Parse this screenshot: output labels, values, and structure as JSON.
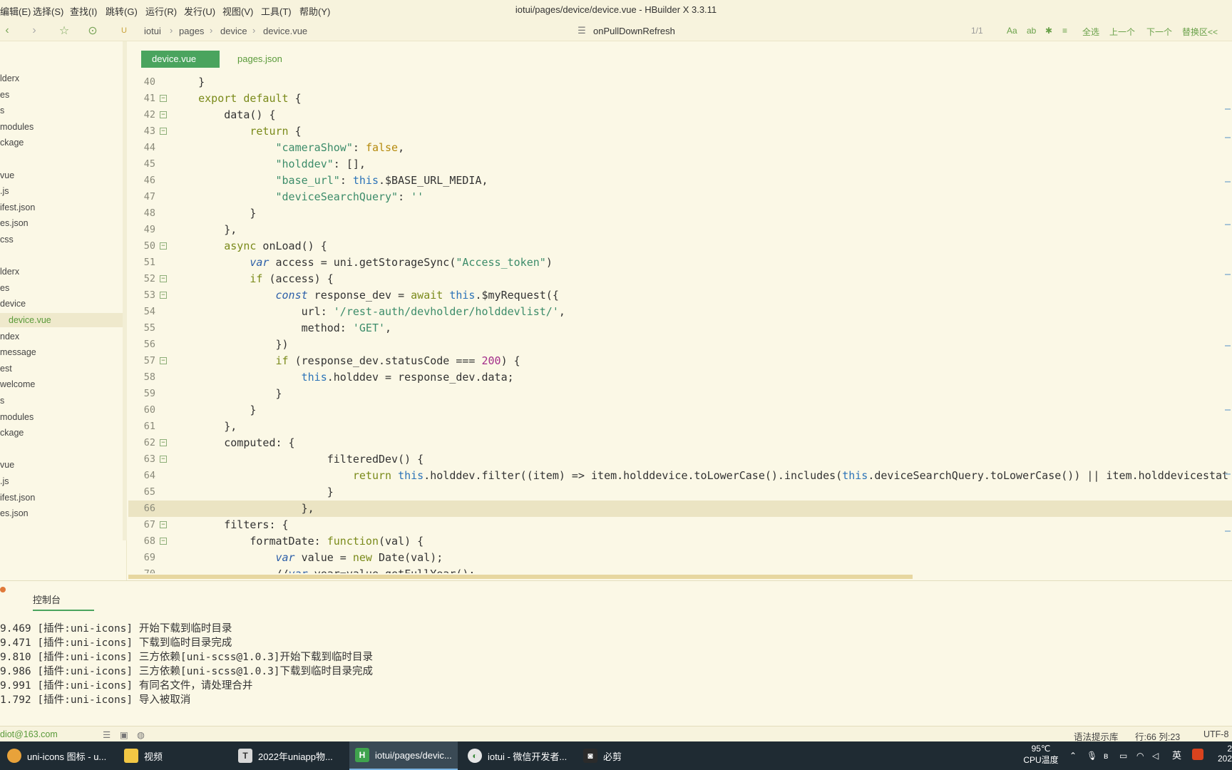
{
  "menubar": {
    "items": [
      "编辑(E)",
      "选择(S)",
      "查找(I)",
      "跳转(G)",
      "运行(R)",
      "发行(U)",
      "视图(V)",
      "工具(T)",
      "帮助(Y)"
    ],
    "title": "iotui/pages/device/device.vue - HBuilder X 3.3.11"
  },
  "toolbar": {
    "breadcrumb": [
      "iotui",
      "pages",
      "device",
      "device.vue"
    ],
    "find_query": "onPullDownRefresh",
    "find_count": "1/1",
    "find_tools": [
      "Aa",
      "ab",
      "全选",
      "上一个",
      "下一个",
      "替换区<<"
    ]
  },
  "sidebar": {
    "items": [
      "lderx",
      "es",
      "s",
      "modules",
      "ckage",
      "",
      "vue",
      ".js",
      "ifest.json",
      "es.json",
      "css",
      "",
      "lderx",
      "es",
      "device",
      "device.vue",
      "ndex",
      "message",
      "est",
      "welcome",
      "s",
      "modules",
      "ckage",
      "",
      "vue",
      ".js",
      "ifest.json",
      "es.json"
    ],
    "active_index": 15
  },
  "tabs": [
    {
      "label": "device.vue",
      "active": true
    },
    {
      "label": "pages.json",
      "active": false
    }
  ],
  "code": {
    "current_line": 66,
    "lines": [
      {
        "n": "40",
        "fold": false,
        "text": "    }"
      },
      {
        "n": "41",
        "fold": true,
        "text": "    export default {"
      },
      {
        "n": "42",
        "fold": true,
        "text": "        data() {"
      },
      {
        "n": "43",
        "fold": true,
        "text": "            return {"
      },
      {
        "n": "44",
        "fold": false,
        "text": "                \"cameraShow\": false,"
      },
      {
        "n": "45",
        "fold": false,
        "text": "                \"holddev\": [],"
      },
      {
        "n": "46",
        "fold": false,
        "text": "                \"base_url\": this.$BASE_URL_MEDIA,"
      },
      {
        "n": "47",
        "fold": false,
        "text": "                \"deviceSearchQuery\": ''"
      },
      {
        "n": "48",
        "fold": false,
        "text": "            }"
      },
      {
        "n": "49",
        "fold": false,
        "text": "        },"
      },
      {
        "n": "50",
        "fold": true,
        "text": "        async onLoad() {"
      },
      {
        "n": "51",
        "fold": false,
        "text": "            var access = uni.getStorageSync(\"Access_token\")"
      },
      {
        "n": "52",
        "fold": true,
        "text": "            if (access) {"
      },
      {
        "n": "53",
        "fold": true,
        "text": "                const response_dev = await this.$myRequest({"
      },
      {
        "n": "54",
        "fold": false,
        "text": "                    url: '/rest-auth/devholder/holddevlist/',"
      },
      {
        "n": "55",
        "fold": false,
        "text": "                    method: 'GET',"
      },
      {
        "n": "56",
        "fold": false,
        "text": "                })"
      },
      {
        "n": "57",
        "fold": true,
        "text": "                if (response_dev.statusCode === 200) {"
      },
      {
        "n": "58",
        "fold": false,
        "text": "                    this.holddev = response_dev.data;"
      },
      {
        "n": "59",
        "fold": false,
        "text": "                }"
      },
      {
        "n": "60",
        "fold": false,
        "text": "            }"
      },
      {
        "n": "61",
        "fold": false,
        "text": "        },"
      },
      {
        "n": "62",
        "fold": true,
        "text": "        computed: {"
      },
      {
        "n": "63",
        "fold": true,
        "text": "                        filteredDev() {"
      },
      {
        "n": "64",
        "fold": false,
        "text": "                            return this.holddev.filter((item) => item.holddevice.toLowerCase().includes(this.deviceSearchQuery.toLowerCase()) || item.holddevicestat"
      },
      {
        "n": "65",
        "fold": false,
        "text": "                        }"
      },
      {
        "n": "66",
        "fold": false,
        "text": "                    },"
      },
      {
        "n": "67",
        "fold": true,
        "text": "        filters: {"
      },
      {
        "n": "68",
        "fold": true,
        "text": "            formatDate: function(val) {"
      },
      {
        "n": "69",
        "fold": false,
        "text": "                var value = new Date(val);"
      },
      {
        "n": "70",
        "fold": false,
        "text": "                //var year=value.getFullYear();"
      }
    ]
  },
  "console": {
    "tab_label": "控制台",
    "lines": [
      "9.469 [插件:uni-icons] 开始下载到临时目录",
      "9.471 [插件:uni-icons] 下载到临时目录完成",
      "9.810 [插件:uni-icons] 三方依赖[uni-scss@1.0.3]开始下载到临时目录",
      "9.986 [插件:uni-icons] 三方依赖[uni-scss@1.0.3]下载到临时目录完成",
      "9.991 [插件:uni-icons] 有同名文件，请处理合并",
      "1.792 [插件:uni-icons] 导入被取消"
    ]
  },
  "statusbar": {
    "account": "diot@163.com",
    "hint": "语法提示库",
    "position": "行:66  列:23",
    "encoding": "UTF-8"
  },
  "taskbar": {
    "tasks": [
      {
        "label": "uni-icons 图标 - u...",
        "icon": "chrome-icon",
        "color": "#e8a23a"
      },
      {
        "label": "视频",
        "icon": "folder-icon",
        "color": "#f2c744"
      },
      {
        "label": "2022年uniapp物...",
        "icon": "typora-icon",
        "color": "#d8d8d8"
      },
      {
        "label": "iotui/pages/devic...",
        "icon": "hbuilder-icon",
        "color": "#3fa34d"
      },
      {
        "label": "iotui - 微信开发者...",
        "icon": "wechat-devtools-icon",
        "color": "#e6e6e6"
      },
      {
        "label": "必剪",
        "icon": "bcut-icon",
        "color": "#2b2b2b"
      }
    ],
    "temp": "95℃",
    "temp_label": "CPU温度",
    "ime": "英",
    "clock_top": "2",
    "clock_bottom": "202"
  }
}
